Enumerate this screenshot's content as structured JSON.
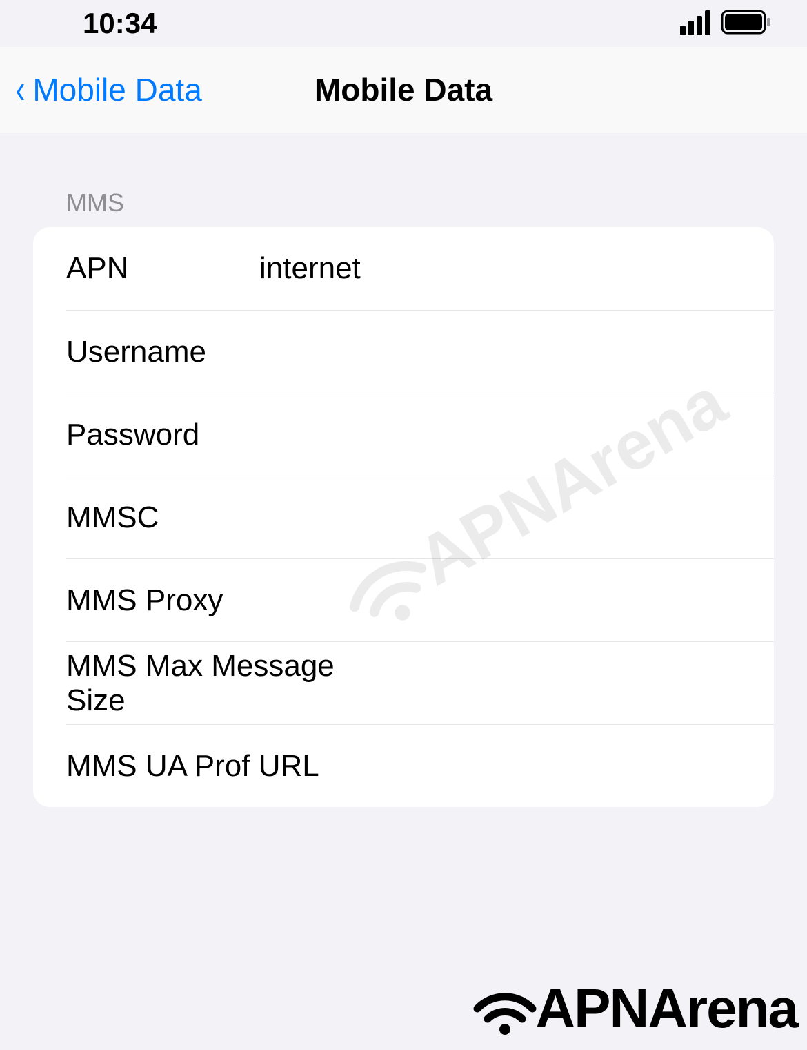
{
  "status": {
    "time": "10:34"
  },
  "nav": {
    "back_label": "Mobile Data",
    "title": "Mobile Data"
  },
  "section": {
    "header": "MMS"
  },
  "fields": {
    "apn": {
      "label": "APN",
      "value": "internet"
    },
    "username": {
      "label": "Username",
      "value": ""
    },
    "password": {
      "label": "Password",
      "value": ""
    },
    "mmsc": {
      "label": "MMSC",
      "value": ""
    },
    "mms_proxy": {
      "label": "MMS Proxy",
      "value": ""
    },
    "mms_max": {
      "label": "MMS Max Message Size",
      "value": ""
    },
    "mms_ua": {
      "label": "MMS UA Prof URL",
      "value": ""
    }
  },
  "watermark": {
    "text": "APNArena"
  }
}
